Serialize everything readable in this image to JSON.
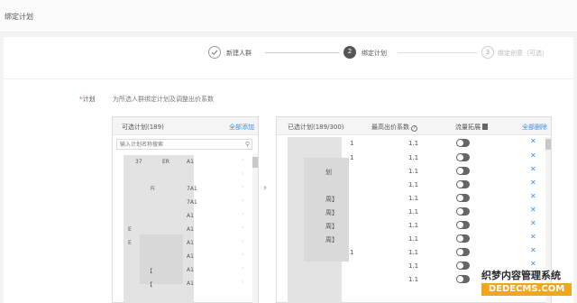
{
  "page": {
    "title": "绑定计划"
  },
  "steps": [
    {
      "number": "",
      "label": "新建人群",
      "state": "done"
    },
    {
      "number": "2",
      "label": "绑定计划",
      "state": "active"
    },
    {
      "number": "3",
      "label": "绑定创意（可选）",
      "state": "pending"
    }
  ],
  "form": {
    "label": "计划",
    "required_mark": "*",
    "hint": "为所选人群绑定计划及调整出价系数"
  },
  "available": {
    "title": "可选计划(189)",
    "add_all": "全部添加",
    "search_placeholder": "输入计划名称搜索",
    "rows": [
      {
        "a": "37",
        "b": "ER",
        "c": "A1"
      },
      {
        "a": "",
        "b": "",
        "c": ""
      },
      {
        "a": "",
        "b": "Fi",
        "c": "7A1"
      },
      {
        "a": "",
        "b": "",
        "c": "7A1"
      },
      {
        "a": "",
        "b": "",
        "c": "A1"
      },
      {
        "a": "E",
        "b": "",
        "c": "A1"
      },
      {
        "a": "E",
        "b": "",
        "c": "A1"
      },
      {
        "a": "",
        "b": "",
        "c": "A1"
      },
      {
        "a": "",
        "b": "【",
        "c": "A1"
      },
      {
        "a": "",
        "b": "【",
        "c": "A1"
      }
    ]
  },
  "selected": {
    "title": "已选计划(189/300)",
    "col_bid": "最高出价系数",
    "col_traffic": "流量拓展",
    "remove_all": "全部删除",
    "rows": [
      {
        "name": "1",
        "bid": "1.1"
      },
      {
        "name": "1",
        "bid": "1.1"
      },
      {
        "name": "划",
        "bid": "1.1"
      },
      {
        "name": "",
        "bid": "1.1"
      },
      {
        "name": "周】",
        "bid": "1.1"
      },
      {
        "name": "周】",
        "bid": "1.1"
      },
      {
        "name": "周】",
        "bid": "1.1"
      },
      {
        "name": "周】",
        "bid": "1.1"
      },
      {
        "name": "1",
        "bid": "1.1"
      },
      {
        "name": "",
        "bid": "1.1"
      },
      {
        "name": "",
        "bid": "1.1"
      }
    ]
  },
  "watermark": {
    "line1": "织梦内容管理系统",
    "line2": "DEDECMS.COM"
  },
  "colors": {
    "link": "#3a8ee6",
    "toggle_off": "#666666",
    "required": "#e05050"
  }
}
